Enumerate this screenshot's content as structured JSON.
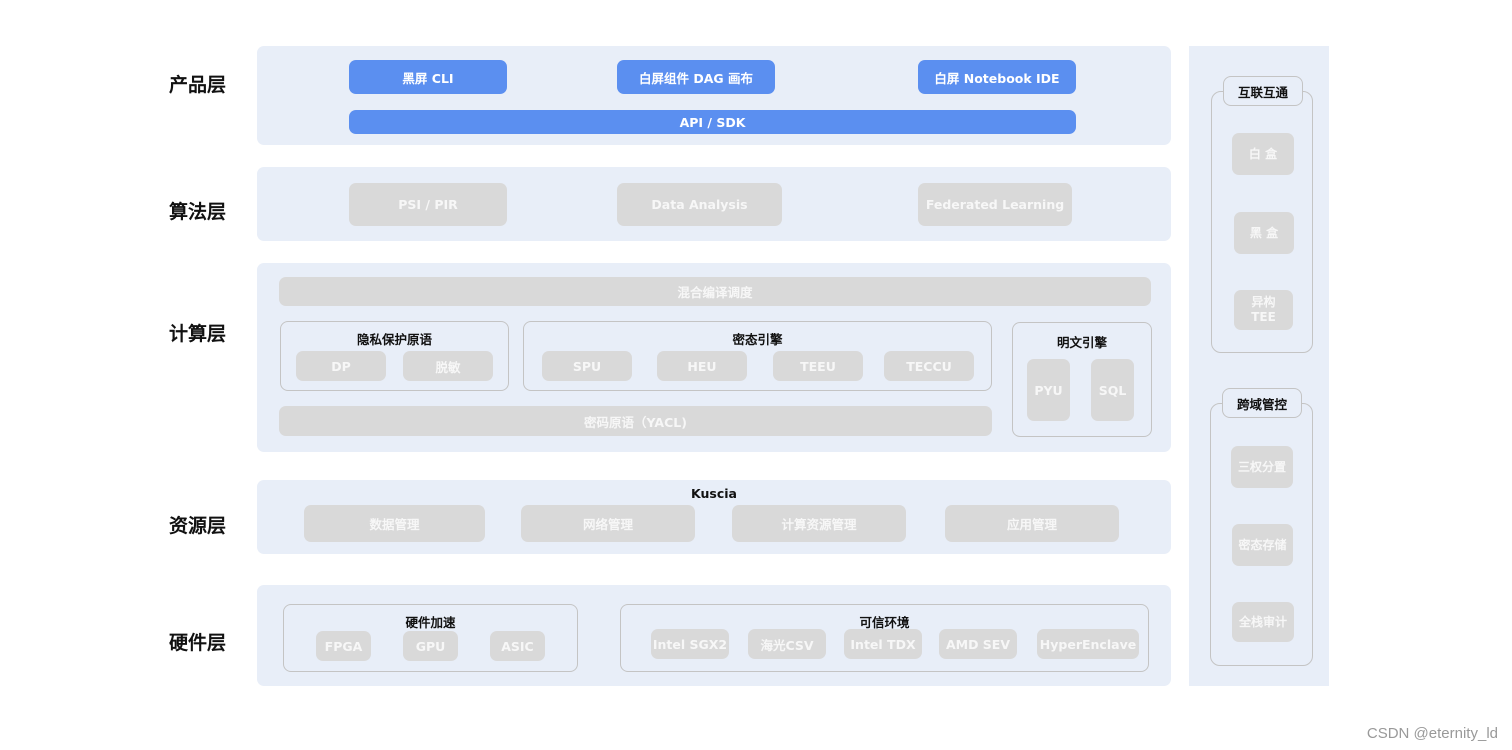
{
  "layers": {
    "product": "产品层",
    "algorithm": "算法层",
    "compute": "计算层",
    "resource": "资源层",
    "hardware": "硬件层"
  },
  "product": {
    "items": [
      "黑屏 CLI",
      "白屏组件 DAG 画布",
      "白屏 Notebook IDE"
    ],
    "api": "API / SDK"
  },
  "algorithm": {
    "items": [
      "PSI / PIR",
      "Data Analysis",
      "Federated Learning"
    ]
  },
  "compute": {
    "scheduler": "混合编译调度",
    "privacy": {
      "title": "隐私保护原语",
      "items": [
        "DP",
        "脱敏"
      ]
    },
    "cipher_engine": {
      "title": "密态引擎",
      "items": [
        "SPU",
        "HEU",
        "TEEU",
        "TECCU"
      ]
    },
    "plain_engine": {
      "title": "明文引擎",
      "items": [
        "PYU",
        "SQL"
      ]
    },
    "yacl": "密码原语（YACL)"
  },
  "resource": {
    "title": "Kuscia",
    "items": [
      "数据管理",
      "网络管理",
      "计算资源管理",
      "应用管理"
    ]
  },
  "hardware": {
    "accel": {
      "title": "硬件加速",
      "items": [
        "FPGA",
        "GPU",
        "ASIC"
      ]
    },
    "trusted": {
      "title": "可信环境",
      "items": [
        "Intel SGX2",
        "海光CSV",
        "Intel TDX",
        "AMD SEV",
        "HyperEnclave"
      ]
    }
  },
  "side": {
    "interop": {
      "title": "互联互通",
      "items": [
        "白 盒",
        "黑 盒",
        "异构\nTEE"
      ]
    },
    "governance": {
      "title": "跨域管控",
      "items": [
        "三权分置",
        "密态存储",
        "全栈审计"
      ]
    }
  },
  "watermark": "CSDN @eternity_ld",
  "colors": {
    "panel": "#e8eef8",
    "blue": "#5b8ff0",
    "grey": "#d9d9d9"
  }
}
